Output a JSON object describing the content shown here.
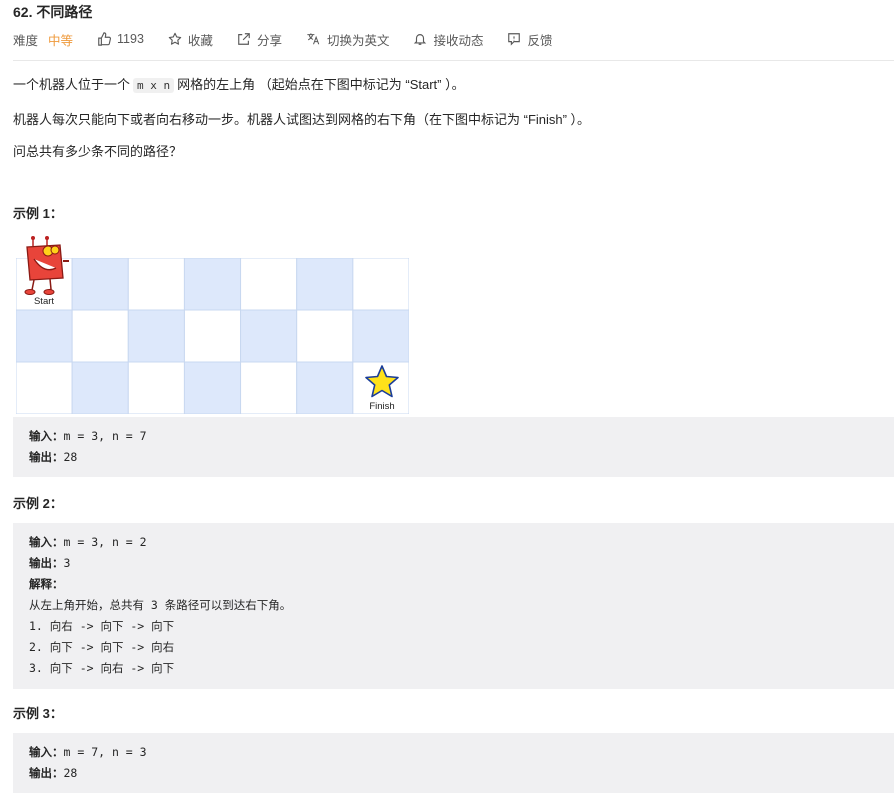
{
  "header": {
    "title": "62. 不同路径",
    "difficulty_label": "难度",
    "difficulty_value": "中等",
    "likes": "1193",
    "favorite": "收藏",
    "share": "分享",
    "switch_lang": "切换为英文",
    "notify": "接收动态",
    "feedback": "反馈"
  },
  "description": {
    "p1_a": "一个机器人位于一个",
    "p1_code": "m x n",
    "p1_b": "网格的左上角 （起始点在下图中标记为 “Start” ）。",
    "p2": "机器人每次只能向下或者向右移动一步。机器人试图达到网格的右下角（在下图中标记为 “Finish” ）。",
    "p3": "问总共有多少条不同的路径？"
  },
  "examples": [
    {
      "title": "示例 1：",
      "lines": [
        {
          "key": "输入：",
          "text": "m = 3, n = 7"
        },
        {
          "key": "输出：",
          "text": "28"
        }
      ]
    },
    {
      "title": "示例 2：",
      "lines": [
        {
          "key": "输入：",
          "text": "m = 3, n = 2"
        },
        {
          "key": "输出：",
          "text": "3"
        },
        {
          "key": "解释：",
          "text": ""
        },
        {
          "key": "",
          "text": "从左上角开始，总共有 3 条路径可以到达右下角。"
        },
        {
          "key": "",
          "text": "1. 向右 -> 向下 -> 向下"
        },
        {
          "key": "",
          "text": "2. 向下 -> 向下 -> 向右"
        },
        {
          "key": "",
          "text": "3. 向下 -> 向右 -> 向下"
        }
      ]
    },
    {
      "title": "示例 3：",
      "lines": [
        {
          "key": "输入：",
          "text": "m = 7, n = 3"
        },
        {
          "key": "输出：",
          "text": "28"
        }
      ]
    }
  ],
  "figure": {
    "start_label": "Start",
    "finish_label": "Finish",
    "rows": 3,
    "cols": 7,
    "colors": {
      "shaded": "#dde8fb",
      "plain": "#ffffff",
      "border": "#c8d8f0",
      "robot": "#e8443a",
      "star": "#ffe21a"
    }
  },
  "colors": {
    "difficulty": "#ef9a3c",
    "code_bg": "#f0f0f2"
  }
}
